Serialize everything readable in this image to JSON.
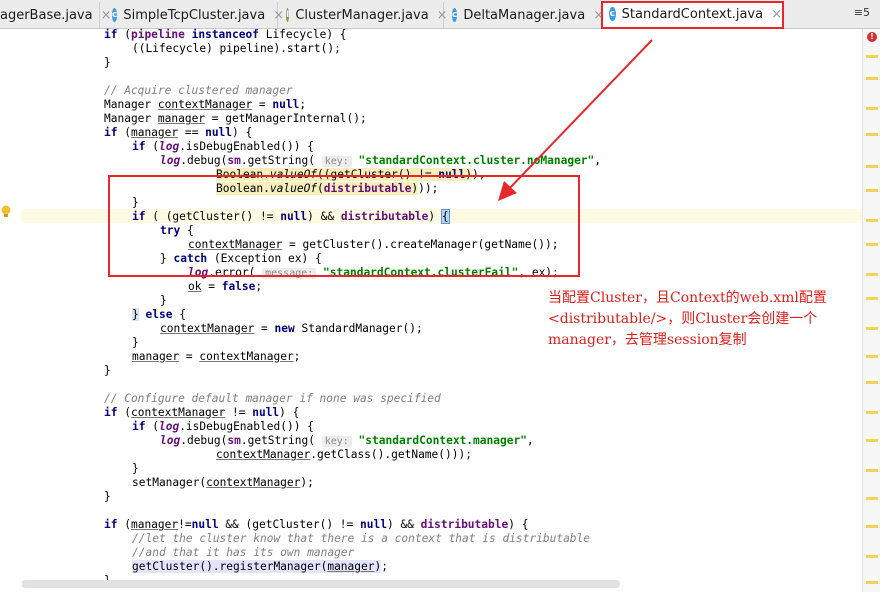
{
  "tabs": [
    {
      "label": "agerBase.java",
      "icon": "c"
    },
    {
      "label": "SimpleTcpCluster.java",
      "icon": "c"
    },
    {
      "label": "ClusterManager.java",
      "icon": "i"
    },
    {
      "label": "DeltaManager.java",
      "icon": "c"
    },
    {
      "label": "StandardContext.java",
      "icon": "c",
      "active": true
    }
  ],
  "tab_menu_label": "≡5",
  "close_glyph": "×",
  "error_glyph": "!",
  "annotation": {
    "line1": "当配置Cluster，且Context的web.xml配置",
    "line2": "<distributable/>，则Cluster会创建一个",
    "line3": "manager，去管理session复制"
  },
  "code": {
    "pipeline_start": "((Lifecycle) pipeline).start();",
    "comment_acquire": "// Acquire clustered manager",
    "comment_configure": "// Configure default manager if none was specified",
    "comment_let1": "//let the cluster know that there is a context that is distributable",
    "comment_let2": "//and that it has its own manager",
    "hint_key": "key:",
    "hint_message": "message:",
    "str_nomanager": "\"standardContext.cluster.noManager\"",
    "str_clusterfail": "\"standardContext.clusterFail\"",
    "str_manager": "\"standardContext.manager\""
  },
  "colors": {
    "annotation_red": "#e6282a",
    "keyword": "#000080",
    "string": "#008000",
    "field": "#660e7a",
    "comment": "#808080"
  }
}
